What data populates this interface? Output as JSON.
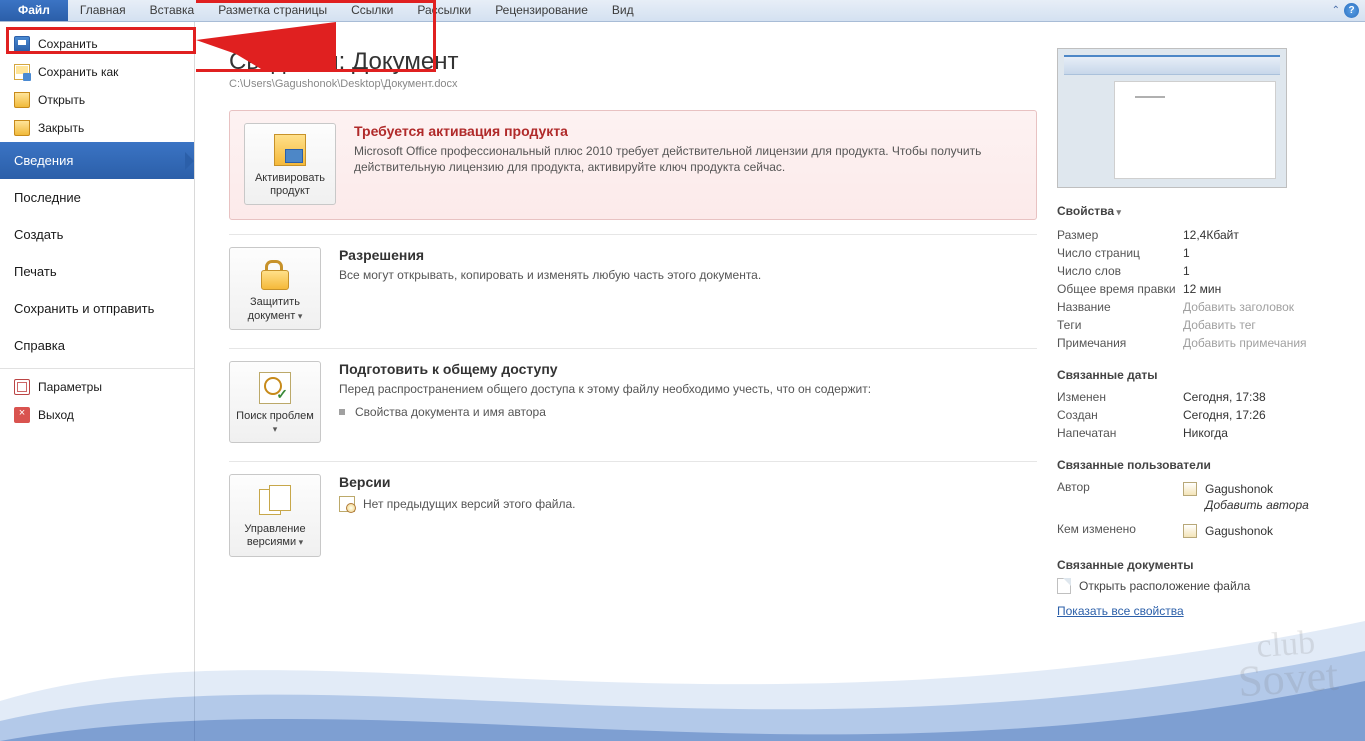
{
  "ribbon": {
    "file": "Файл",
    "tabs": [
      "Главная",
      "Вставка",
      "Разметка страницы",
      "Ссылки",
      "Рассылки",
      "Рецензирование",
      "Вид"
    ]
  },
  "nav": {
    "save": "Сохранить",
    "save_as": "Сохранить как",
    "open": "Открыть",
    "close": "Закрыть",
    "info": "Сведения",
    "recent": "Последние",
    "new": "Создать",
    "print": "Печать",
    "share": "Сохранить и отправить",
    "help": "Справка",
    "options": "Параметры",
    "exit": "Выход"
  },
  "header": {
    "title": "Сведения: Документ",
    "path": "C:\\Users\\Gagushonok\\Desktop\\Документ.docx"
  },
  "sections": {
    "activate": {
      "button": "Активировать продукт",
      "title": "Требуется активация продукта",
      "body": "Microsoft Office профессиональный плюс 2010 требует действительной лицензии для продукта. Чтобы получить действительную лицензию для продукта, активируйте ключ продукта сейчас."
    },
    "perm": {
      "button": "Защитить документ",
      "title": "Разрешения",
      "body": "Все могут открывать, копировать и изменять любую часть этого документа."
    },
    "prepare": {
      "button": "Поиск проблем",
      "title": "Подготовить к общему доступу",
      "body": "Перед распространением общего доступа к этому файлу необходимо учесть, что он содержит:",
      "bullet1": "Свойства документа и имя автора"
    },
    "versions": {
      "button": "Управление версиями",
      "title": "Версии",
      "none": "Нет предыдущих версий этого файла."
    }
  },
  "right": {
    "props_header": "Свойства",
    "rows": {
      "size_k": "Размер",
      "size_v": "12,4Кбайт",
      "pages_k": "Число страниц",
      "pages_v": "1",
      "words_k": "Число слов",
      "words_v": "1",
      "edit_k": "Общее время правки",
      "edit_v": "12 мин",
      "title_k": "Название",
      "title_ph": "Добавить заголовок",
      "tags_k": "Теги",
      "tags_ph": "Добавить тег",
      "notes_k": "Примечания",
      "notes_ph": "Добавить примечания"
    },
    "dates_header": "Связанные даты",
    "dates": {
      "modified_k": "Изменен",
      "modified_v": "Сегодня, 17:38",
      "created_k": "Создан",
      "created_v": "Сегодня, 17:26",
      "printed_k": "Напечатан",
      "printed_v": "Никогда"
    },
    "people_header": "Связанные пользователи",
    "author_k": "Автор",
    "author_v": "Gagushonok",
    "add_author": "Добавить автора",
    "lastmod_k": "Кем изменено",
    "lastmod_v": "Gagushonok",
    "docs_header": "Связанные документы",
    "open_location": "Открыть расположение файла",
    "show_all": "Показать все свойства"
  },
  "watermark": {
    "l1": "club",
    "l2": "Sovet"
  }
}
